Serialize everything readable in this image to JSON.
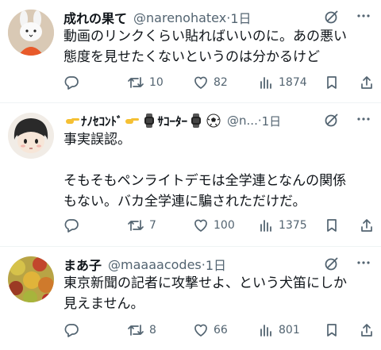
{
  "tweets": [
    {
      "name": "成れの果て",
      "handle": "@narenohatex",
      "sep": "·",
      "time": "1日",
      "text": "動画のリンクくらい貼ればいいのに。あの悪い\n態度を見せたくないというのは分かるけど",
      "replies": "",
      "retweets": "10",
      "likes": "82",
      "views": "1874"
    },
    {
      "name_parts": [
        "ﾅﾉｾｺﾝﾄﾞ",
        "ｻｺｰﾀｰ"
      ],
      "handle": "@n...",
      "sep": "·",
      "time": "1日",
      "text": "事実誤認。\n\nそもそもペンライトデモは全学連となんの関係\nもない。バカ全学連に騙されただけだ。",
      "replies": "",
      "retweets": "7",
      "likes": "100",
      "views": "1375"
    },
    {
      "name": "まあ子",
      "handle": "@maaaacodes",
      "sep": "·",
      "time": "1日",
      "text": "東京新聞の記者に攻撃せよ、という犬笛にしか\n見えません。",
      "replies": "",
      "retweets": "8",
      "likes": "66",
      "views": "801"
    }
  ],
  "icons": {
    "reply": "reply-icon",
    "retweet": "retweet-icon",
    "like": "heart-icon",
    "views": "views-icon",
    "bookmark": "bookmark-icon",
    "share": "share-icon",
    "grok": "grok-icon",
    "more": "more-icon"
  },
  "colors": {
    "text": "#0f1419",
    "secondary": "#536471",
    "divider": "#eff3f4"
  }
}
